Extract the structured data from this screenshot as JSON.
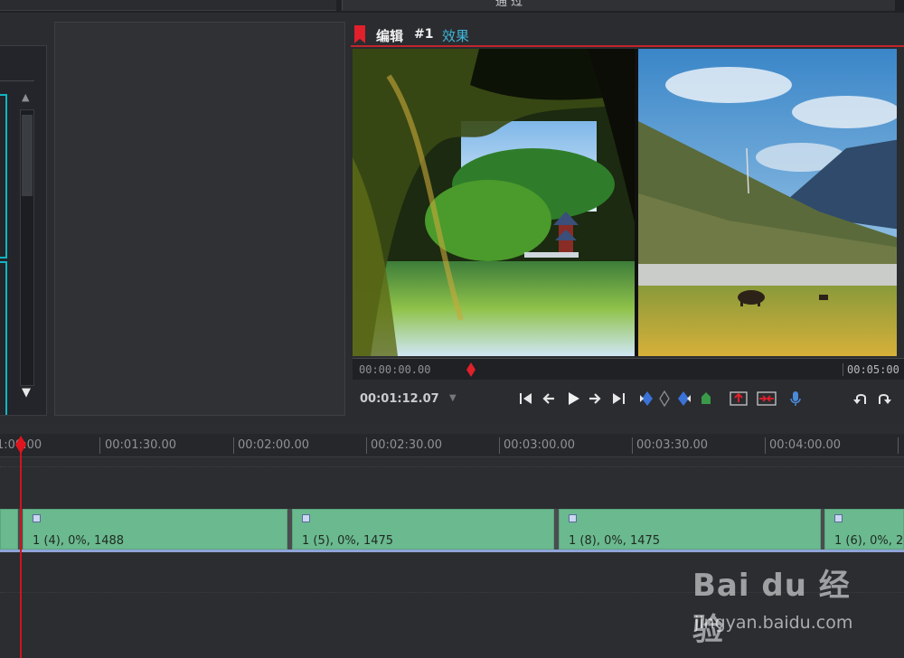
{
  "top": {
    "tab_label": "通 过"
  },
  "preview": {
    "title": "编辑",
    "number": "#1",
    "effects_label": "效果",
    "ruler_start": "00:00:00.00",
    "ruler_end": "00:05:00",
    "current_time": "00:01:12.07",
    "colors": {
      "accent": "#c0262c",
      "link": "#3fb6d8"
    }
  },
  "timeline": {
    "ruler_labels": [
      "1:00:00",
      "00:01:30.00",
      "00:02:00.00",
      "00:02:30.00",
      "00:03:00.00",
      "00:03:30.00",
      "00:04:00.00"
    ],
    "clips": [
      {
        "label": "1 (4), 0%, 1488"
      },
      {
        "label": "1 (5), 0%, 1475"
      },
      {
        "label": "1 (8), 0%, 1475"
      },
      {
        "label": "1 (6), 0%, 2"
      }
    ],
    "colors": {
      "clip": "#6bb98f",
      "playhead": "#d0141c",
      "track_line": "#8fa4d8"
    }
  },
  "watermark": {
    "brand": "Bai du 经验",
    "url": "jingyan.baidu.com"
  }
}
